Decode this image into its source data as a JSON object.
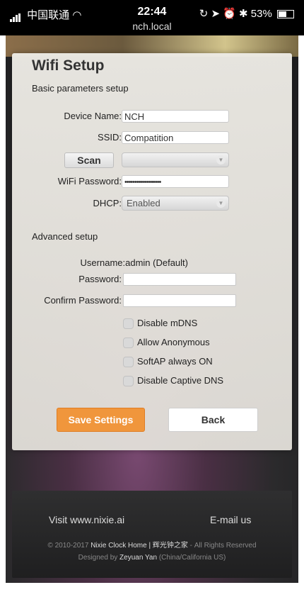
{
  "status_bar": {
    "carrier": "中国联通",
    "time": "22:44",
    "url": "nch.local",
    "battery": "53%"
  },
  "panel": {
    "title": "Wifi Setup",
    "subtitle": "Basic parameters setup",
    "device_name_label": "Device Name:",
    "device_name_value": "NCH",
    "ssid_label": "SSID:",
    "ssid_value": "Compatition",
    "scan_label": "Scan",
    "scan_select_value": "",
    "password_label": "WiFi Password:",
    "password_value": "••••••••••••••••••",
    "dhcp_label": "DHCP:",
    "dhcp_value": "Enabled",
    "advanced_title": "Advanced setup",
    "username_text": "Username:admin (Default)",
    "adv_password_label": "Password:",
    "adv_password_value": "",
    "confirm_password_label": "Confirm Password:",
    "confirm_password_value": "",
    "checkboxes": [
      {
        "label": "Disable mDNS",
        "checked": false
      },
      {
        "label": "Allow Anonymous",
        "checked": false
      },
      {
        "label": "SoftAP always ON",
        "checked": false
      },
      {
        "label": "Disable Captive DNS",
        "checked": false
      }
    ],
    "save_label": "Save Settings",
    "back_label": "Back"
  },
  "footer": {
    "visit_link": "Visit www.nixie.ai",
    "email_link": "E-mail us",
    "copyright_prefix": "© 2010-2017",
    "copyright_site": "Nixie Clock Home | 辉光钟之家",
    "copyright_suffix": "- All Rights Reserved",
    "designed_prefix": "Designed by",
    "designer": "Zeyuan Yan",
    "designer_location": "(China/California US)"
  },
  "colors": {
    "accent": "#f0963c",
    "panel": "#ebe9e4",
    "footer": "#2a2a2b"
  }
}
